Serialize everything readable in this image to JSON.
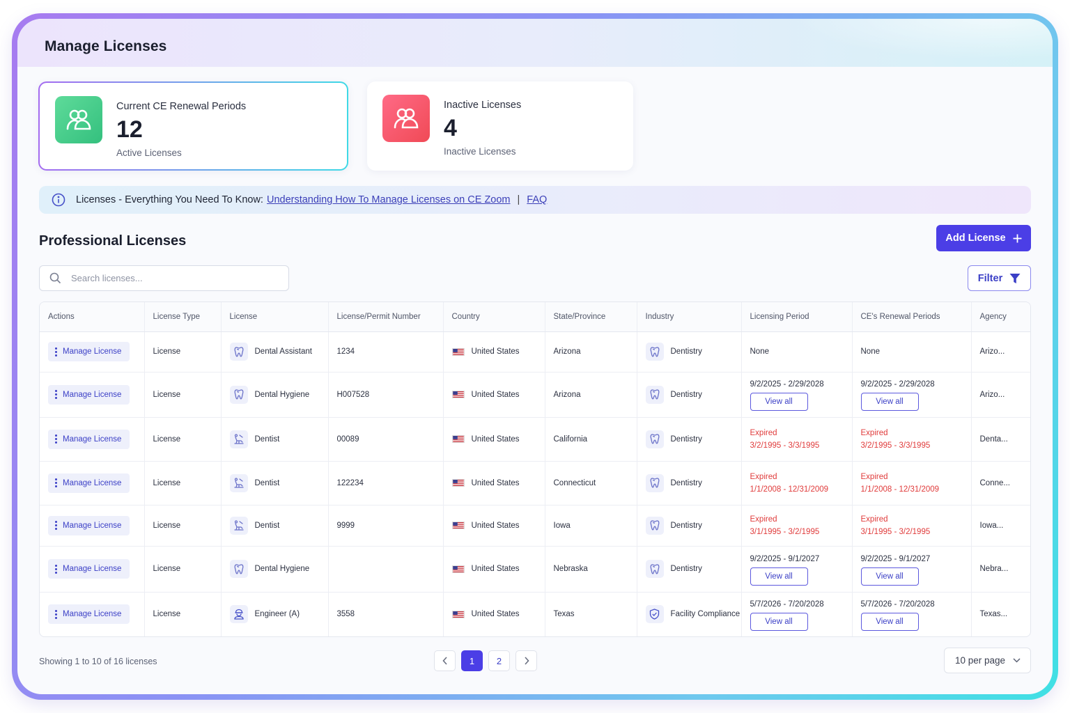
{
  "page": {
    "title": "Manage Licenses"
  },
  "stats": {
    "active": {
      "title": "Current CE Renewal Periods",
      "value": "12",
      "sub": "Active Licenses",
      "color": "#34c07e"
    },
    "inactive": {
      "title": "Inactive Licenses",
      "value": "4",
      "sub": "Inactive Licenses",
      "color": "#f04a56"
    }
  },
  "banner": {
    "lead": "Licenses - Everything You Need To Know:",
    "link1": "Understanding How To Manage Licenses on CE Zoom",
    "separator": "|",
    "link2": "FAQ"
  },
  "section": {
    "title": "Professional Licenses",
    "add_label": "Add License",
    "filter_label": "Filter"
  },
  "search": {
    "placeholder": "Search licenses..."
  },
  "table": {
    "headers": [
      "Actions",
      "License Type",
      "License",
      "License/Permit Number",
      "Country",
      "State/Province",
      "Industry",
      "Licensing Period",
      "CE's Renewal Periods",
      "Agency"
    ],
    "manage_label": "Manage License",
    "view_all_label": "View all",
    "expired_label": "Expired",
    "rows": [
      {
        "type": "License",
        "license": "Dental Assistant",
        "icon": "tooth-icon",
        "number": "1234",
        "country": "United States",
        "state": "Arizona",
        "industry": "Dentistry",
        "industry_icon": "tooth-icon",
        "period": "None",
        "period_status": "none",
        "ce": "None",
        "ce_status": "none",
        "agency": "Arizo..."
      },
      {
        "type": "License",
        "license": "Dental Hygiene",
        "icon": "tooth-icon",
        "number": "H007528",
        "country": "United States",
        "state": "Arizona",
        "industry": "Dentistry",
        "industry_icon": "tooth-icon",
        "period": "9/2/2025 - 2/29/2028",
        "period_status": "active",
        "ce": "9/2/2025 - 2/29/2028",
        "ce_status": "active",
        "agency": "Arizo..."
      },
      {
        "type": "License",
        "license": "Dentist",
        "icon": "dental-chair-icon",
        "number": "00089",
        "country": "United States",
        "state": "California",
        "industry": "Dentistry",
        "industry_icon": "tooth-icon",
        "period": "3/2/1995 - 3/3/1995",
        "period_status": "expired",
        "ce": "3/2/1995 - 3/3/1995",
        "ce_status": "expired",
        "agency": "Denta..."
      },
      {
        "type": "License",
        "license": "Dentist",
        "icon": "dental-chair-icon",
        "number": "122234",
        "country": "United States",
        "state": "Connecticut",
        "industry": "Dentistry",
        "industry_icon": "tooth-icon",
        "period": "1/1/2008 - 12/31/2009",
        "period_status": "expired",
        "ce": "1/1/2008 - 12/31/2009",
        "ce_status": "expired",
        "agency": "Conne..."
      },
      {
        "type": "License",
        "license": "Dentist",
        "icon": "dental-chair-icon",
        "number": "9999",
        "country": "United States",
        "state": "Iowa",
        "industry": "Dentistry",
        "industry_icon": "tooth-icon",
        "period": "3/1/1995 - 3/2/1995",
        "period_status": "expired",
        "ce": "3/1/1995 - 3/2/1995",
        "ce_status": "expired",
        "agency": "Iowa..."
      },
      {
        "type": "License",
        "license": "Dental Hygiene",
        "icon": "tooth-icon",
        "number": "",
        "country": "United States",
        "state": "Nebraska",
        "industry": "Dentistry",
        "industry_icon": "tooth-icon",
        "period": "9/2/2025 - 9/1/2027",
        "period_status": "active",
        "ce": "9/2/2025 - 9/1/2027",
        "ce_status": "active",
        "agency": "Nebra..."
      },
      {
        "type": "License",
        "license": "Engineer (A)",
        "icon": "engineer-icon",
        "number": "3558",
        "country": "United States",
        "state": "Texas",
        "industry": "Facility Compliance",
        "industry_icon": "shield-check-icon",
        "period": "5/7/2026 - 7/20/2028",
        "period_status": "active",
        "ce": "5/7/2026 - 7/20/2028",
        "ce_status": "active",
        "agency": "Texas..."
      }
    ]
  },
  "pagination": {
    "showing": "Showing 1 to 10 of 16 licenses",
    "pages": [
      "1",
      "2"
    ],
    "current": "1",
    "per_page": "10 per page"
  },
  "colors": {
    "accent": "#4b3ee6",
    "expired": "#e03b3b"
  }
}
